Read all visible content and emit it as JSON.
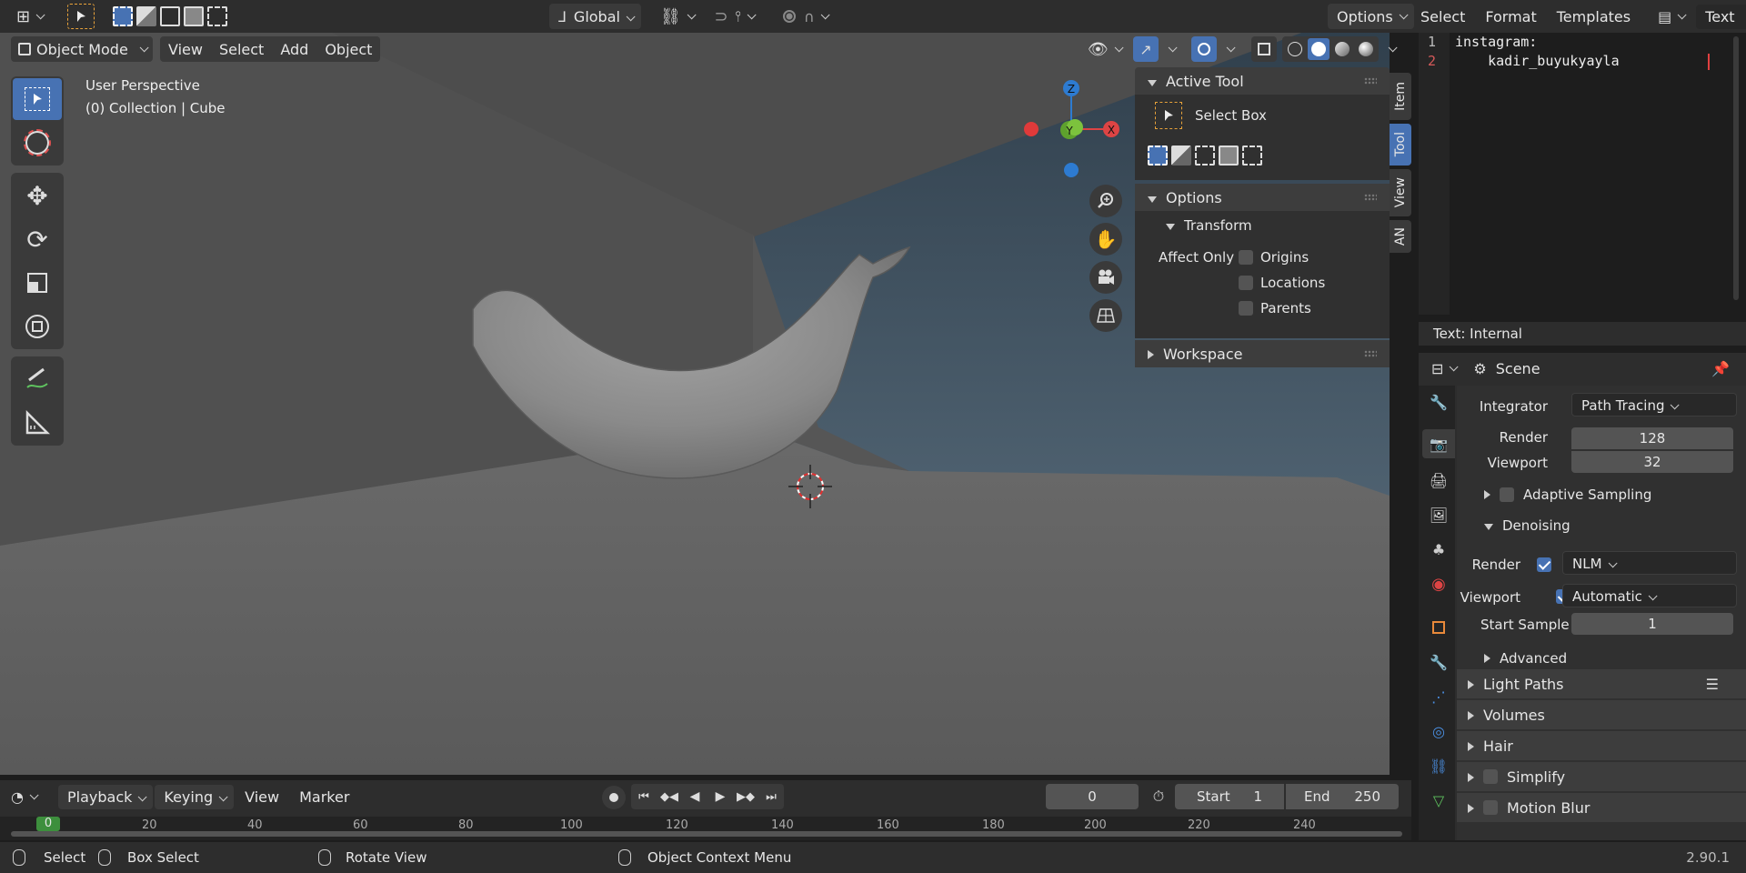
{
  "viewport_header": {
    "transform_orientation": "Global",
    "options_label": "Options",
    "mode": "Object Mode",
    "menus": [
      "View",
      "Select",
      "Add",
      "Object"
    ]
  },
  "viewport": {
    "perspective": "User Perspective",
    "collection": "(0) Collection | Cube",
    "gizmo": {
      "z": "Z",
      "x": "X",
      "y": "Y"
    }
  },
  "tool_panel": {
    "active_tool": "Active Tool",
    "tool_name": "Select Box",
    "options": "Options",
    "transform": "Transform",
    "affect_only": "Affect Only",
    "origins": "Origins",
    "locations": "Locations",
    "parents": "Parents",
    "workspace": "Workspace",
    "tabs": [
      "Item",
      "Tool",
      "View",
      "AN"
    ]
  },
  "text_editor": {
    "menus": [
      "Select",
      "Format",
      "Templates"
    ],
    "text_label": "Text",
    "line_numbers": [
      "1",
      "2"
    ],
    "lines": [
      "instagram:",
      "    kadir_buyukyayla"
    ],
    "footer": "Text: Internal"
  },
  "properties": {
    "scene": "Scene",
    "integrator_label": "Integrator",
    "integrator": "Path Tracing",
    "render_label": "Render",
    "render_samples": "128",
    "viewport_label": "Viewport",
    "viewport_samples": "32",
    "adaptive_sampling": "Adaptive Sampling",
    "denoising": "Denoising",
    "denoise_render_label": "Render",
    "denoise_render": "NLM",
    "denoise_viewport_label": "Viewport",
    "denoise_viewport": "Automatic",
    "start_sample_label": "Start Sample",
    "start_sample": "1",
    "advanced": "Advanced",
    "light_paths": "Light Paths",
    "volumes": "Volumes",
    "hair": "Hair",
    "simplify": "Simplify",
    "motion_blur": "Motion Blur"
  },
  "timeline": {
    "menus": [
      "Playback",
      "Keying",
      "View",
      "Marker"
    ],
    "current_frame": "0",
    "start_label": "Start",
    "start": "1",
    "end_label": "End",
    "end": "250",
    "ticks": [
      "0",
      "20",
      "40",
      "60",
      "80",
      "100",
      "120",
      "140",
      "160",
      "180",
      "200",
      "220",
      "240"
    ]
  },
  "statusbar": {
    "select": "Select",
    "box_select": "Box Select",
    "rotate_view": "Rotate View",
    "context_menu": "Object Context Menu",
    "version": "2.90.1"
  }
}
